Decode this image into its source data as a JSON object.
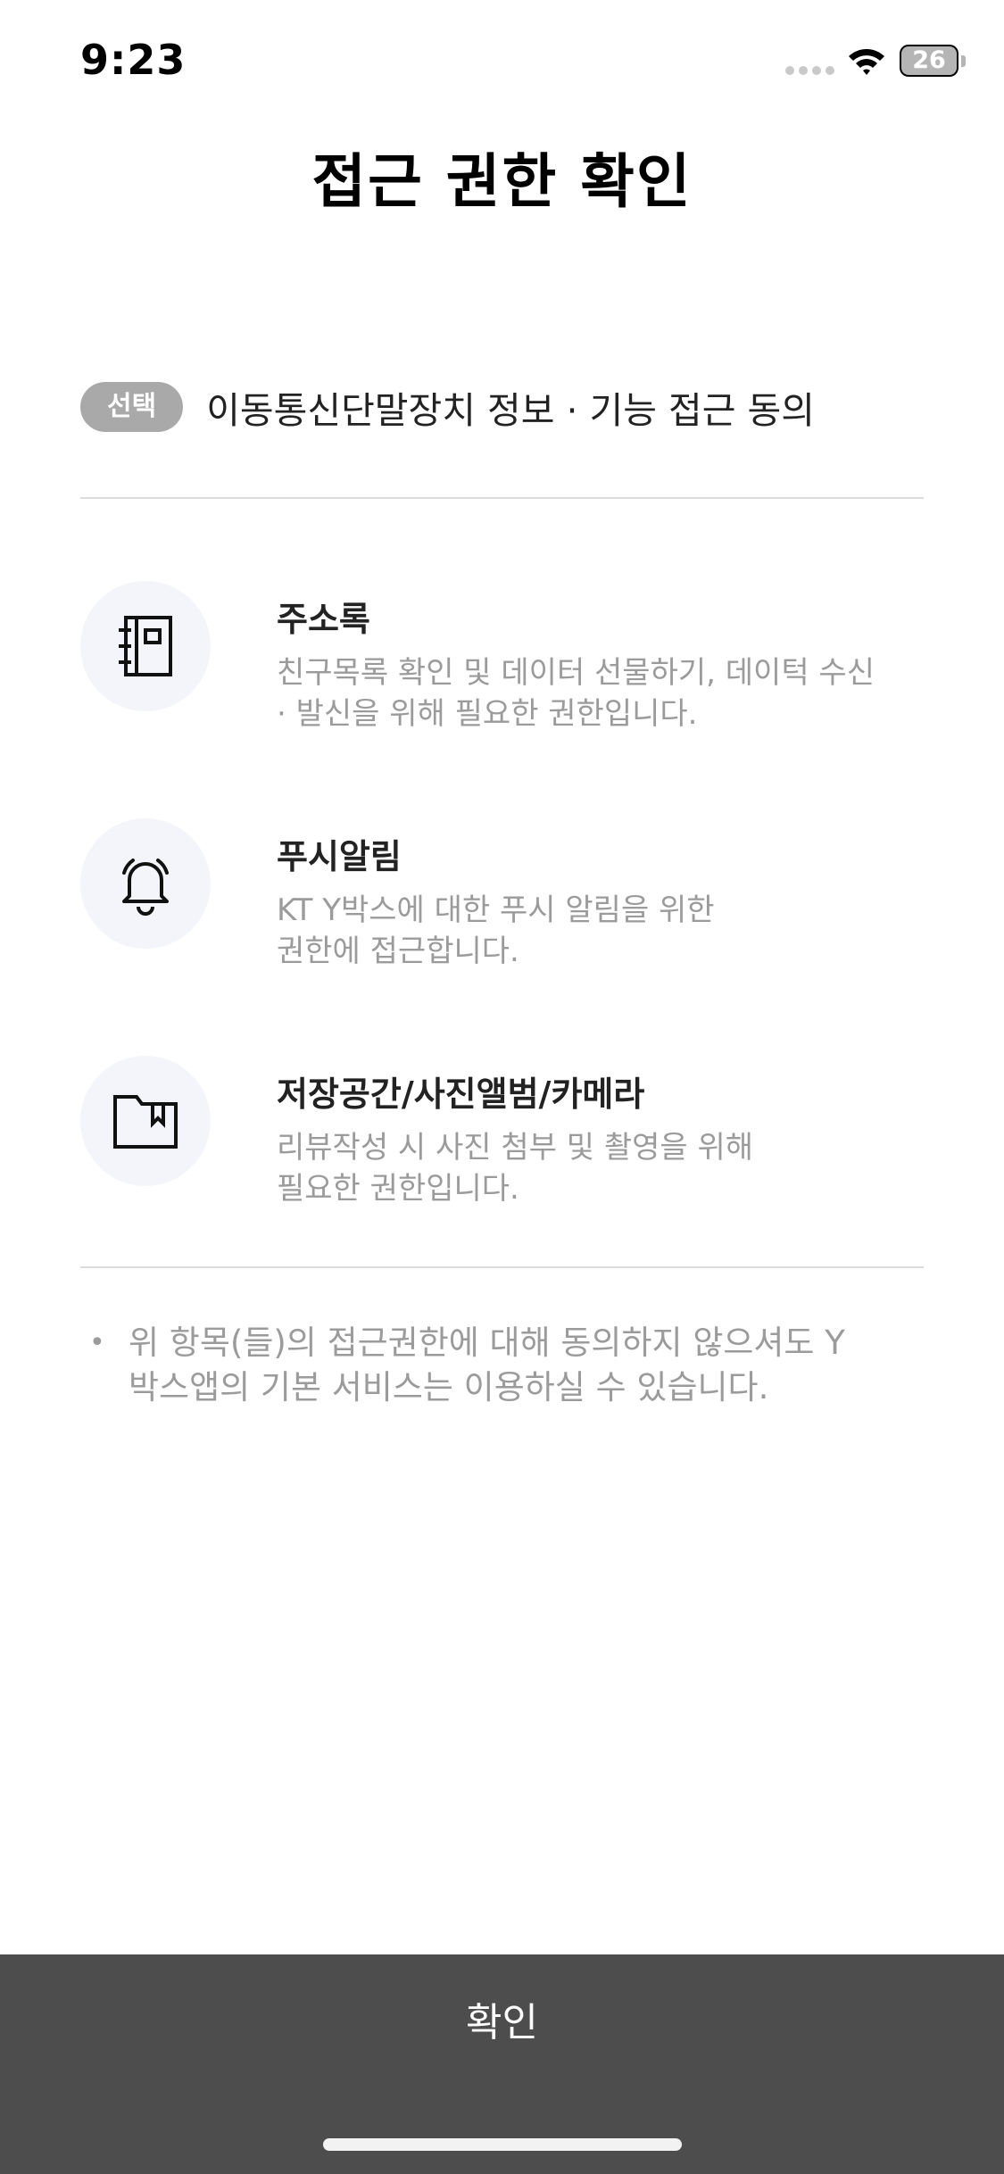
{
  "status_bar": {
    "time": "9:23",
    "battery_level": "26",
    "icons": [
      "signal-icon",
      "wifi-icon",
      "battery-icon"
    ]
  },
  "title": "접근 권한 확인",
  "consent": {
    "badge": "선택",
    "label": "이동통신단말장치 정보 · 기능 접근 동의"
  },
  "permissions": [
    {
      "icon": "address-book-icon",
      "title": "주소록",
      "desc_line1": "친구목록 확인 및 데이터 선물하기, 데이턱 수신",
      "desc_line2": "· 발신을 위해 필요한 권한입니다."
    },
    {
      "icon": "bell-icon",
      "title": "푸시알림",
      "desc_line1": "KT Y박스에 대한 푸시 알림을 위한",
      "desc_line2": "권한에 접근합니다."
    },
    {
      "icon": "folder-icon",
      "title": "저장공간/사진앨범/카메라",
      "desc_line1": "리뷰작성 시 사진 첨부 및 촬영을 위해",
      "desc_line2": "필요한 권한입니다."
    }
  ],
  "notice": {
    "bullet": "•",
    "line1": "위 항목(들)의 접근권한에 대해 동의하지 않으셔도 Y",
    "line2": "박스앱의 기본 서비스는 이용하실 수 있습니다."
  },
  "confirm_label": "확인",
  "colors": {
    "badge_bg": "#a9a9a9",
    "icon_circle_bg": "#f4f5fb",
    "button_bg": "#4d4d4d",
    "muted_text": "#9b9b9b"
  }
}
